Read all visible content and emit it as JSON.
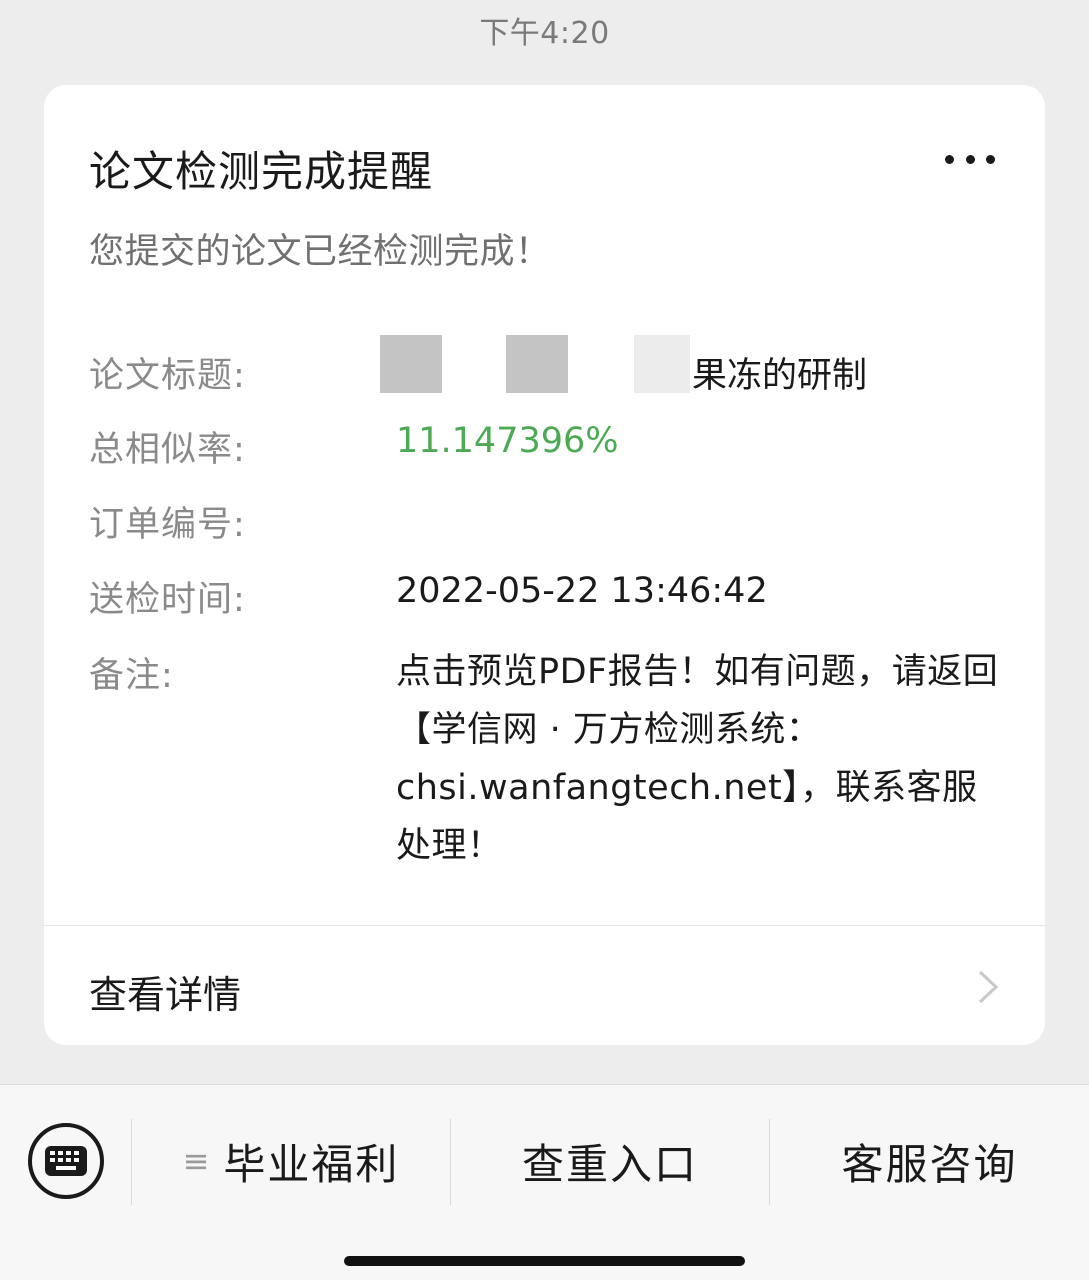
{
  "status_bar": {
    "time": "下午4:20"
  },
  "card": {
    "title": "论文检测完成提醒",
    "more_icon": "more-dots-icon",
    "subtitle": "您提交的论文已经检测完成！",
    "fields": {
      "title_label": "论文标题:",
      "title_value": "果冻的研制",
      "similarity_label": "总相似率:",
      "similarity_value": "11.147396%",
      "order_label": "订单编号:",
      "order_value": "",
      "time_label": "送检时间:",
      "time_value": "2022-05-22 13:46:42",
      "remark_label": "备注:",
      "remark_value": "点击预览PDF报告！如有问题，请返回【学信网 · 万方检测系统：chsi.wanfangtech.net】，联系客服处理！"
    },
    "details_label": "查看详情",
    "details_icon": "chevron-right-icon"
  },
  "bottom_menu": {
    "keyboard_icon": "keyboard-icon",
    "items": [
      {
        "label": "毕业福利",
        "icon": "menu-lines-icon",
        "icon_glyph": "≡"
      },
      {
        "label": "查重入口"
      },
      {
        "label": "客服咨询"
      }
    ]
  },
  "colors": {
    "similarity": "#4caa55",
    "background": "#ededed",
    "card": "#ffffff"
  }
}
